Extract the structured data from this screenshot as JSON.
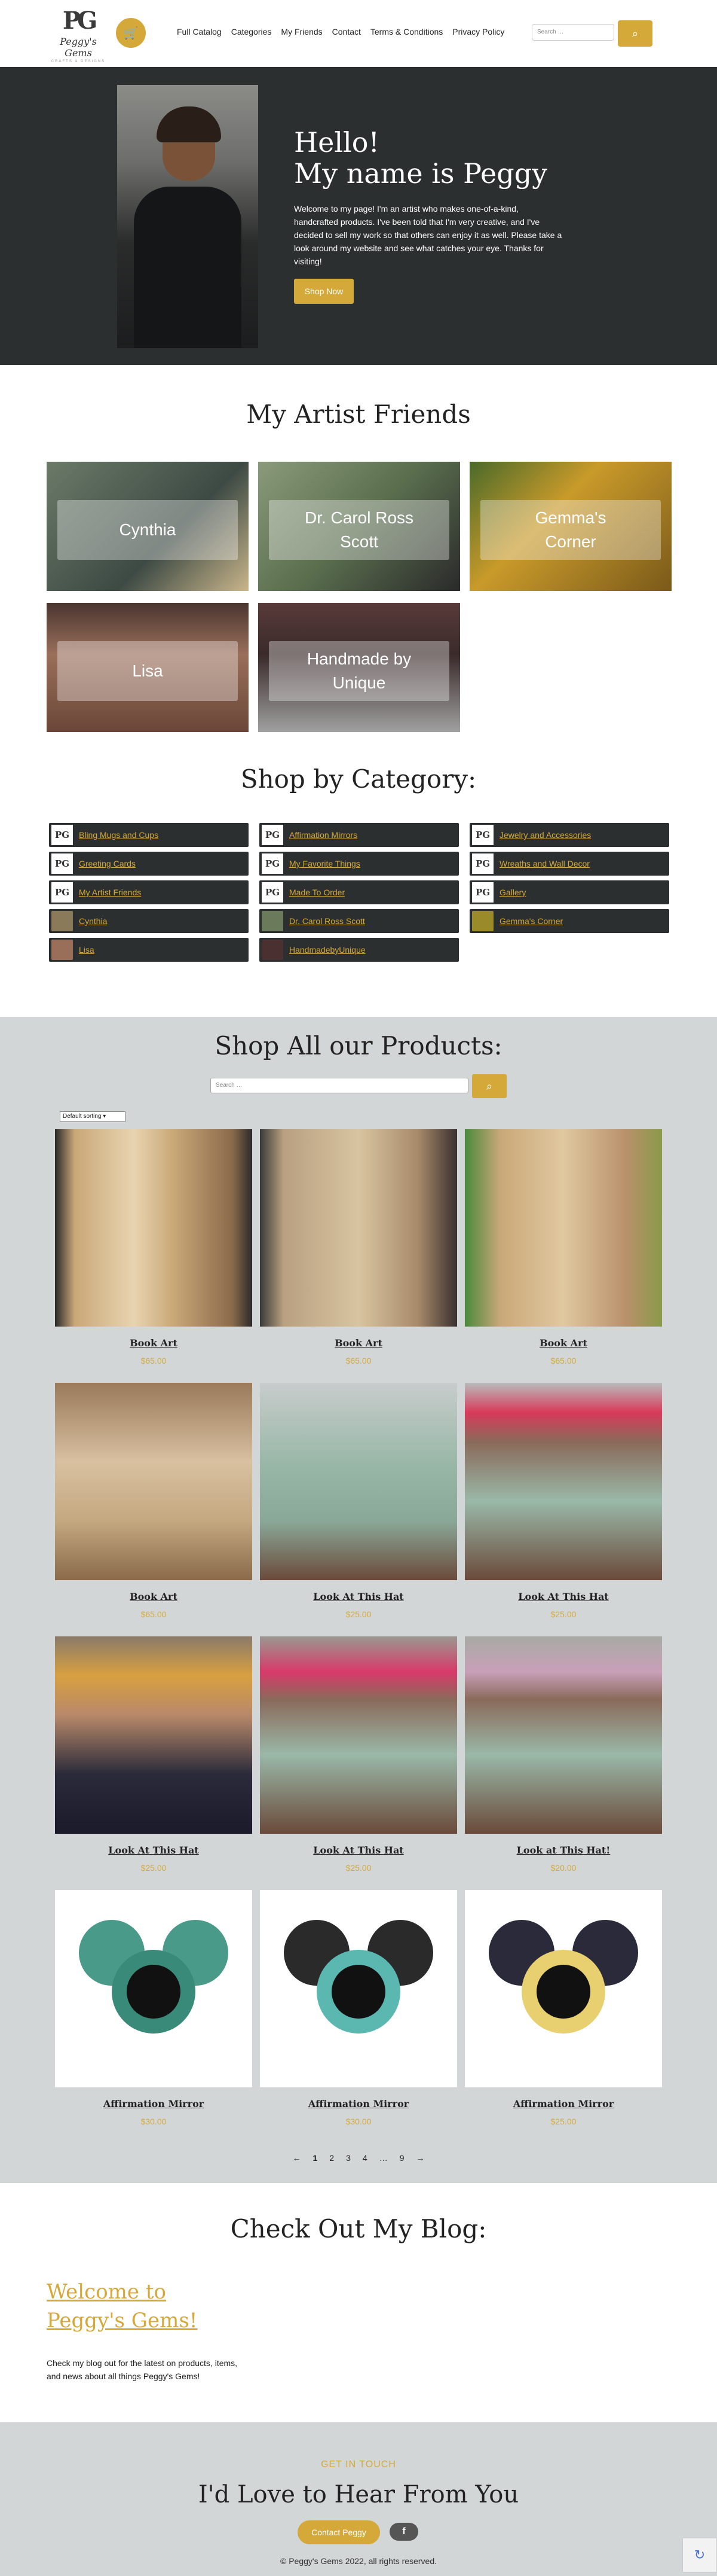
{
  "header": {
    "logo_text": "PG",
    "logo_name": "Peggy's Gems",
    "logo_sub": "CRAFTS & DESIGNS",
    "cart_icon": "cart-icon",
    "nav": [
      "Full Catalog",
      "Categories",
      "My Friends",
      "Contact",
      "Terms & Conditions",
      "Privacy Policy"
    ],
    "search_placeholder": "Search …",
    "search_icon": "search-icon"
  },
  "hero": {
    "title_line1": "Hello!",
    "title_line2": "My name is Peggy",
    "text": "Welcome to my page! I'm an artist who makes one-of-a-kind, handcrafted products. I've been told that I'm very creative, and I've decided to sell my work so that others can enjoy it as well. Please take a look around my website and see what catches your eye. Thanks for visiting!",
    "button": "Shop Now"
  },
  "friends": {
    "title": "My Artist Friends",
    "cards": [
      "Cynthia",
      "Dr. Carol Ross Scott",
      "Gemma's Corner",
      "Lisa",
      "Handmade by Unique"
    ]
  },
  "categories": {
    "title": "Shop by Category:",
    "col1": [
      "Bling Mugs and Cups",
      "Greeting Cards",
      "My Artist Friends",
      "Cynthia",
      "Lisa"
    ],
    "col2": [
      "Affirmation Mirrors",
      "My Favorite Things",
      "Made To Order",
      "Dr. Carol Ross Scott",
      "HandmadebyUnique"
    ],
    "col3": [
      "Jewelry and Accessories",
      "Wreaths and Wall Decor",
      "Gallery",
      "Gemma's Corner"
    ]
  },
  "shop": {
    "title": "Shop All our Products:",
    "search_placeholder": "Search …",
    "sort": "Default sorting",
    "products": [
      {
        "name": "Book Art",
        "price": "$65.00"
      },
      {
        "name": "Book Art",
        "price": "$65.00"
      },
      {
        "name": "Book Art",
        "price": "$65.00"
      },
      {
        "name": "Book Art",
        "price": "$65.00"
      },
      {
        "name": "Look At This Hat",
        "price": "$25.00"
      },
      {
        "name": "Look At This Hat",
        "price": "$25.00"
      },
      {
        "name": "Look At This Hat",
        "price": "$25.00"
      },
      {
        "name": "Look At This Hat",
        "price": "$25.00"
      },
      {
        "name": "Look at This Hat!",
        "price": "$20.00"
      },
      {
        "name": "Affirmation Mirror",
        "price": "$30.00"
      },
      {
        "name": "Affirmation Mirror",
        "price": "$30.00"
      },
      {
        "name": "Affirmation Mirror",
        "price": "$25.00"
      }
    ],
    "pagination": [
      "←",
      "1",
      "2",
      "3",
      "4",
      "…",
      "9",
      "→"
    ]
  },
  "blog": {
    "title": "Check Out My Blog:",
    "post_title": "Welcome to Peggy's Gems!",
    "post_text": "Check my blog out for the latest on products, items, and news about all things Peggy's Gems!"
  },
  "contact": {
    "kicker": "GET IN TOUCH",
    "title": "I'd Love to Hear From You",
    "button": "Contact Peggy",
    "social_icon": "facebook-icon",
    "copyright": "© Peggy's Gems 2022, all rights reserved."
  },
  "colors": {
    "accent": "#d4a93a",
    "dark": "#2c2f2f",
    "gray_bg": "#d2d6d6"
  }
}
